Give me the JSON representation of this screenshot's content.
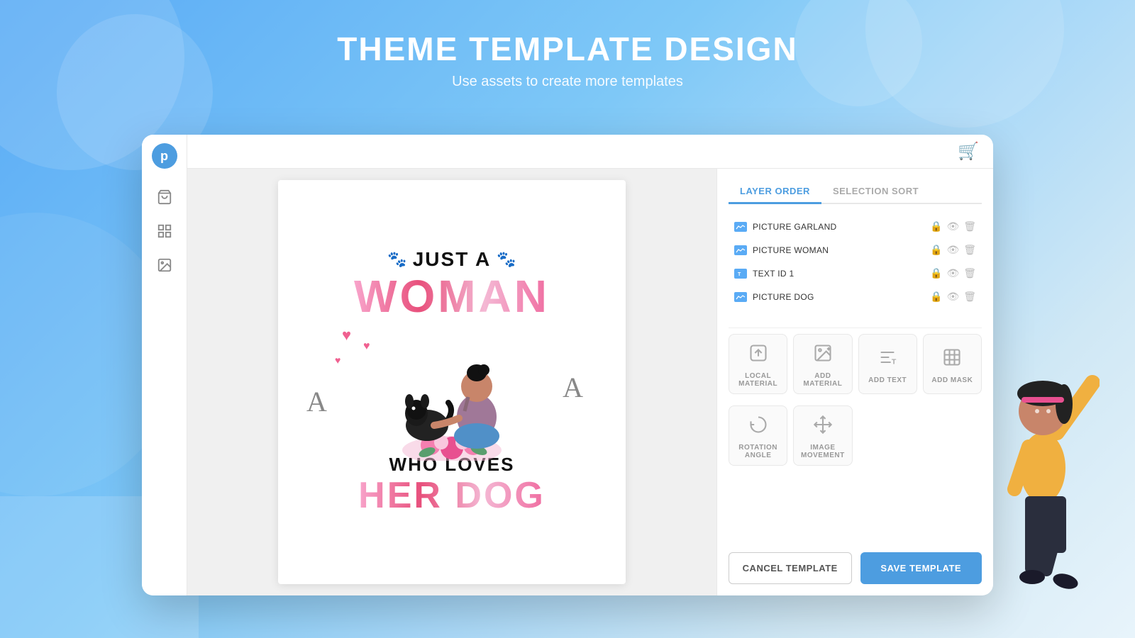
{
  "header": {
    "title": "THEME TEMPLATE DESIGN",
    "subtitle": "Use assets to create more templates"
  },
  "sidebar": {
    "logo_letter": "p",
    "icons": [
      {
        "name": "shopping-bag-icon",
        "symbol": "🛍"
      },
      {
        "name": "grid-icon",
        "symbol": "⊞"
      },
      {
        "name": "image-icon",
        "symbol": "🖼"
      }
    ]
  },
  "topbar": {
    "cart_icon": "🛒"
  },
  "tabs": [
    {
      "label": "LAYER ORDER",
      "active": true
    },
    {
      "label": "SELECTION SORT",
      "active": false
    }
  ],
  "layers": [
    {
      "name": "PICTURE GARLAND",
      "type": "image"
    },
    {
      "name": "PICTURE WOMAN",
      "type": "image"
    },
    {
      "name": "TEXT ID 1",
      "type": "text"
    },
    {
      "name": "PICTURE DOG",
      "type": "image"
    }
  ],
  "tools_row1": [
    {
      "name": "local-material-tool",
      "label": "LOCAL MATERIAL",
      "icon": "⬆"
    },
    {
      "name": "add-material-tool",
      "label": "ADD MATERIAL",
      "icon": "🖼"
    },
    {
      "name": "add-text-tool",
      "label": "ADD TEXT",
      "icon": "T"
    },
    {
      "name": "add-mask-tool",
      "label": "ADD MASK",
      "icon": "▨"
    }
  ],
  "tools_row2": [
    {
      "name": "rotation-angle-tool",
      "label": "ROTATION ANGLE",
      "icon": "↺"
    },
    {
      "name": "image-movement-tool",
      "label": "IMAGE MOVEMENT",
      "icon": "⤢"
    }
  ],
  "buttons": {
    "cancel": "CANCEL TEMPLATE",
    "save": "SAVE TEMPLATE"
  },
  "canvas": {
    "text_just_a": "✿ JUST A ✿",
    "text_woman": "WOMAN",
    "text_who_loves": "WHO LOVES",
    "text_her_dog": "HER DOG",
    "letter_a_1": "A",
    "letter_a_2": "A"
  }
}
